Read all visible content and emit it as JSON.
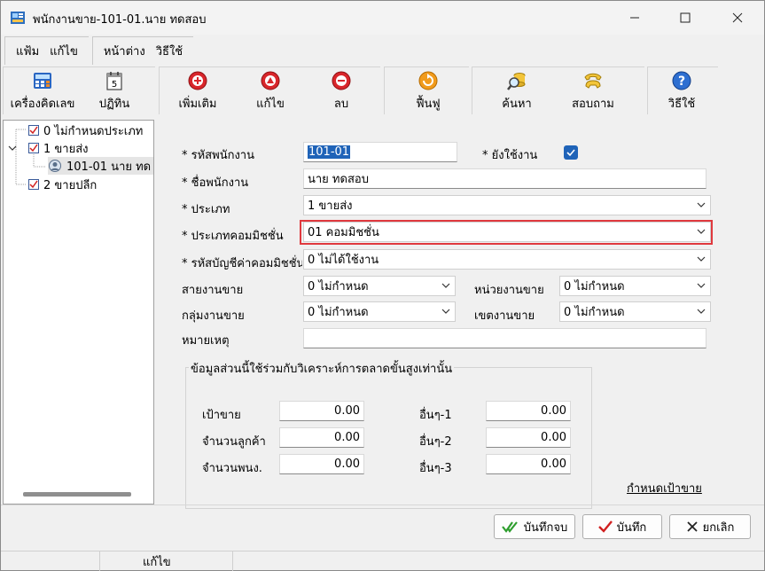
{
  "window": {
    "title": "พนักงานขาย-101-01.นาย ทดสอบ"
  },
  "menubar": {
    "group1": [
      "แฟ้ม",
      "แก้ไข"
    ],
    "group2": [
      "หน้าต่าง",
      "วิธีใช้"
    ]
  },
  "toolbar": {
    "calculator": "เครื่องคิดเลข",
    "calendar": "ปฏิทิน",
    "calendar_day": "5",
    "add": "เพิ่มเติม",
    "edit": "แก้ไข",
    "delete": "ลบ",
    "restore": "ฟื้นฟู",
    "search": "ค้นหา",
    "inquiry": "สอบถาม",
    "help": "วิธีใช้"
  },
  "tree": {
    "items": [
      {
        "label": "0 ไม่กำหนดประเภท"
      },
      {
        "label": "1 ขายส่ง"
      },
      {
        "label": "101-01 นาย ทด"
      },
      {
        "label": "2 ขายปลีก"
      }
    ]
  },
  "form": {
    "emp_code_label": "* รหัสพนักงาน",
    "emp_code_value": "101-01",
    "active_label": "* ยังใช้งาน",
    "emp_name_label": "* ชื่อพนักงาน",
    "emp_name_value": "นาย ทดสอบ",
    "type_label": "* ประเภท",
    "type_value": "1 ขายส่ง",
    "commission_type_label": "* ประเภทคอมมิชชั่น",
    "commission_type_value": "01 คอมมิชชั่น",
    "commission_account_label": "* รหัสบัญชีค่าคอมมิชชั่น",
    "commission_account_value": "0 ไม่ได้ใช้งาน",
    "sales_line_label": "สายงานขาย",
    "sales_line_value": "0 ไม่กำหนด",
    "sales_unit_label": "หน่วยงานขาย",
    "sales_unit_value": "0 ไม่กำหนด",
    "sales_group_label": "กลุ่มงานขาย",
    "sales_group_value": "0 ไม่กำหนด",
    "sales_zone_label": "เขตงานขาย",
    "sales_zone_value": "0 ไม่กำหนด",
    "remark_label": "หมายเหตุ",
    "remark_value": ""
  },
  "analysis": {
    "title": "ข้อมูลส่วนนี้ใช้ร่วมกับวิเคราะห์การตลาดขั้นสูงเท่านั้น",
    "target_label": "เป้าขาย",
    "target_value": "0.00",
    "customers_label": "จำนวนลูกค้า",
    "customers_value": "0.00",
    "staff_label": "จำนวนพนง.",
    "staff_value": "0.00",
    "other1_label": "อื่นๆ-1",
    "other1_value": "0.00",
    "other2_label": "อื่นๆ-2",
    "other2_value": "0.00",
    "other3_label": "อื่นๆ-3",
    "other3_value": "0.00",
    "set_target_link": "กำหนดเป้าขาย"
  },
  "buttons": {
    "save_close": "บันทึกจบ",
    "save": "บันทึก",
    "cancel": "ยกเลิก"
  },
  "statusbar": {
    "mode": "แก้ไข"
  },
  "colors": {
    "highlight": "#e0393e",
    "checkbox": "#1f63b8",
    "selection": "#1f63b8"
  }
}
